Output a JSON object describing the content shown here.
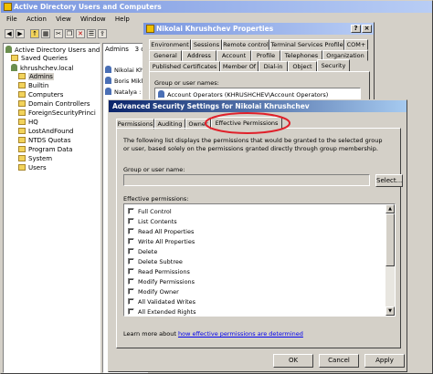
{
  "aduc": {
    "title": "Active Directory Users and Computers",
    "menu": [
      "File",
      "Action",
      "View",
      "Window",
      "Help"
    ],
    "tree": [
      {
        "label": "Active Directory Users and C",
        "indent": 0,
        "icon": "domain"
      },
      {
        "label": "Saved Queries",
        "indent": 1,
        "icon": "folder"
      },
      {
        "label": "khrushchev.local",
        "indent": 1,
        "icon": "domain"
      },
      {
        "label": "Admins",
        "indent": 2,
        "icon": "folder"
      },
      {
        "label": "Builtin",
        "indent": 2,
        "icon": "folder"
      },
      {
        "label": "Computers",
        "indent": 2,
        "icon": "folder"
      },
      {
        "label": "Domain Controllers",
        "indent": 2,
        "icon": "folder"
      },
      {
        "label": "ForeignSecurityPrinci",
        "indent": 2,
        "icon": "folder"
      },
      {
        "label": "HQ",
        "indent": 2,
        "icon": "folder"
      },
      {
        "label": "LostAndFound",
        "indent": 2,
        "icon": "folder"
      },
      {
        "label": "NTDS Quotas",
        "indent": 2,
        "icon": "folder"
      },
      {
        "label": "Program Data",
        "indent": 2,
        "icon": "folder"
      },
      {
        "label": "System",
        "indent": 2,
        "icon": "folder"
      },
      {
        "label": "Users",
        "indent": 2,
        "icon": "folder"
      }
    ],
    "list_header": "Admins   3 c",
    "list_items": [
      "Nikolai Kh",
      "Boris Mikl",
      "Natalya :"
    ]
  },
  "props": {
    "title": "Nikolai Khrushchev Properties",
    "tabs_row1": [
      "Environment",
      "Sessions",
      "Remote control",
      "Terminal Services Profile",
      "COM+"
    ],
    "tabs_row2": [
      "General",
      "Address",
      "Account",
      "Profile",
      "Telephones",
      "Organization"
    ],
    "tabs_row3": [
      "Published Certificates",
      "Member Of",
      "Dial-in",
      "Object",
      "Security"
    ],
    "group_label": "Group or user names:",
    "group_item": "Account Operators (KHRUSHCHEV\\Account Operators)"
  },
  "adv": {
    "title": "Advanced Security Settings for Nikolai Khrushchev",
    "tabs": [
      "Permissions",
      "Auditing",
      "Owner",
      "Effective Permissions"
    ],
    "description": "The following list displays the permissions that would be granted to the selected group or user, based solely on the permissions granted directly through group membership.",
    "group_label": "Group or user name:",
    "select_button": "Select...",
    "effective_label": "Effective permissions:",
    "permissions": [
      "Full Control",
      "List Contents",
      "Read All Properties",
      "Write All Properties",
      "Delete",
      "Delete Subtree",
      "Read Permissions",
      "Modify Permissions",
      "Modify Owner",
      "All Validated Writes",
      "All Extended Rights"
    ],
    "learn_more_prefix": "Learn more about ",
    "learn_more_link": "how effective permissions are determined",
    "ok_button": "OK",
    "cancel_button": "Cancel",
    "apply_button": "Apply"
  }
}
